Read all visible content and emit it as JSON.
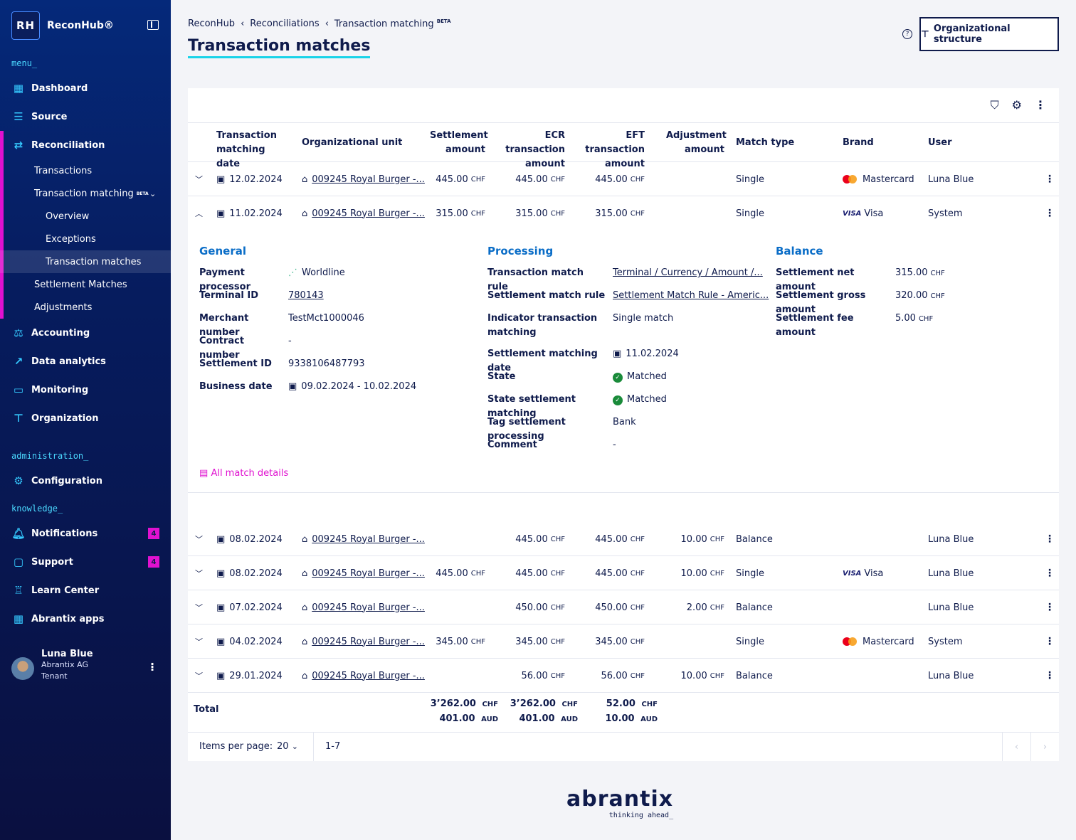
{
  "app": {
    "logo_mark": "RH",
    "name": "ReconHub®"
  },
  "sidebar": {
    "menu_label": "menu_",
    "admin_label": "administration_",
    "knowledge_label": "knowledge_",
    "items": [
      {
        "label": "Dashboard"
      },
      {
        "label": "Source"
      },
      {
        "label": "Reconciliation"
      },
      {
        "label": "Accounting"
      },
      {
        "label": "Data analytics"
      },
      {
        "label": "Monitoring"
      },
      {
        "label": "Organization"
      }
    ],
    "recon_sub": [
      "Transactions",
      "Transaction matching",
      "Settlement Matches",
      "Adjustments"
    ],
    "beta": "BETA",
    "tm_sub": [
      "Overview",
      "Exceptions",
      "Transaction matches"
    ],
    "admin_items": [
      {
        "label": "Configuration"
      }
    ],
    "knowledge_items": [
      {
        "label": "Notifications",
        "badge": "4"
      },
      {
        "label": "Support",
        "badge": "4"
      },
      {
        "label": "Learn Center"
      },
      {
        "label": "Abrantix apps"
      }
    ],
    "user": {
      "name": "Luna Blue",
      "company": "Abrantix AG",
      "role": "Tenant"
    }
  },
  "header": {
    "breadcrumb": [
      "ReconHub",
      "Reconciliations",
      "Transaction matching"
    ],
    "beta": "BETA",
    "title": "Transaction matches",
    "org_button": "Organizational structure"
  },
  "table": {
    "columns": [
      "Transaction matching date",
      "Organizational unit",
      "Settlement amount",
      "ECR transaction amount",
      "EFT transaction amount",
      "Adjustment amount",
      "Match type",
      "Brand",
      "User"
    ],
    "rows": [
      {
        "date": "12.02.2024",
        "unit": "009245 Royal Burger -...",
        "settlement": "445.00",
        "ecr": "445.00",
        "eft": "445.00",
        "adjust": "",
        "type": "Single",
        "brand": "Mastercard",
        "user": "Luna Blue",
        "expanded": false
      },
      {
        "date": "11.02.2024",
        "unit": "009245 Royal Burger -...",
        "settlement": "315.00",
        "ecr": "315.00",
        "eft": "315.00",
        "adjust": "",
        "type": "Single",
        "brand": "Visa",
        "user": "System",
        "expanded": true
      },
      {
        "date": "08.02.2024",
        "unit": "009245 Royal Burger -...",
        "settlement": "",
        "ecr": "445.00",
        "eft": "445.00",
        "adjust": "10.00",
        "type": "Balance",
        "brand": "",
        "user": "Luna Blue",
        "expanded": false
      },
      {
        "date": "08.02.2024",
        "unit": "009245 Royal Burger -...",
        "settlement": "445.00",
        "ecr": "445.00",
        "eft": "445.00",
        "adjust": "10.00",
        "type": "Single",
        "brand": "Visa",
        "user": "Luna Blue",
        "expanded": false
      },
      {
        "date": "07.02.2024",
        "unit": "009245 Royal Burger -...",
        "settlement": "",
        "ecr": "450.00",
        "eft": "450.00",
        "adjust": "2.00",
        "type": "Balance",
        "brand": "",
        "user": "Luna Blue",
        "expanded": false
      },
      {
        "date": "04.02.2024",
        "unit": "009245 Royal Burger -...",
        "settlement": "345.00",
        "ecr": "345.00",
        "eft": "345.00",
        "adjust": "",
        "type": "Single",
        "brand": "Mastercard",
        "user": "System",
        "expanded": false
      },
      {
        "date": "29.01.2024",
        "unit": "009245 Royal Burger -...",
        "settlement": "",
        "ecr": "56.00",
        "eft": "56.00",
        "adjust": "10.00",
        "type": "Balance",
        "brand": "",
        "user": "Luna Blue",
        "expanded": false
      }
    ],
    "currency": "CHF"
  },
  "details": {
    "general_title": "General",
    "general": [
      {
        "label": "Payment processor",
        "value": "Worldline"
      },
      {
        "label": "Terminal ID",
        "value": "780143"
      },
      {
        "label": "Merchant number",
        "value": "TestMct1000046"
      },
      {
        "label": "Contract number",
        "value": "-"
      },
      {
        "label": "Settlement ID",
        "value": "9338106487793"
      },
      {
        "label": "Business date",
        "value": "09.02.2024 - 10.02.2024"
      }
    ],
    "processing_title": "Processing",
    "processing": [
      {
        "label": "Transaction match rule",
        "value": "Terminal / Currency / Amount /..."
      },
      {
        "label": "Settlement match rule",
        "value": "Settlement Match Rule - Americ..."
      },
      {
        "label": "Indicator transaction matching",
        "value": "Single match"
      },
      {
        "label": "Settlement matching date",
        "value": "11.02.2024"
      },
      {
        "label": "State",
        "value": "Matched"
      },
      {
        "label": "State settlement matching",
        "value": "Matched"
      },
      {
        "label": "Tag settlement processing",
        "value": "Bank"
      },
      {
        "label": "Comment",
        "value": "-"
      }
    ],
    "balance_title": "Balance",
    "balance": [
      {
        "label": "Settlement net amount",
        "value": "315.00"
      },
      {
        "label": "Settlement gross amount",
        "value": "320.00"
      },
      {
        "label": "Settlement fee amount",
        "value": "5.00"
      }
    ],
    "all_match_details": "All match details"
  },
  "totals": {
    "label": "Total",
    "settlement": [
      {
        "amount": "3’262.00",
        "cur": "CHF"
      },
      {
        "amount": "401.00",
        "cur": "AUD"
      }
    ],
    "ecr": [
      {
        "amount": "3’262.00",
        "cur": "CHF"
      },
      {
        "amount": "401.00",
        "cur": "AUD"
      }
    ],
    "adjust": [
      {
        "amount": "52.00",
        "cur": "CHF"
      },
      {
        "amount": "10.00",
        "cur": "AUD"
      }
    ]
  },
  "pager": {
    "label": "Items per page:",
    "size": "20",
    "range": "1-7"
  },
  "footer": {
    "logo": "abrantix",
    "tagline": "thinking ahead_"
  }
}
